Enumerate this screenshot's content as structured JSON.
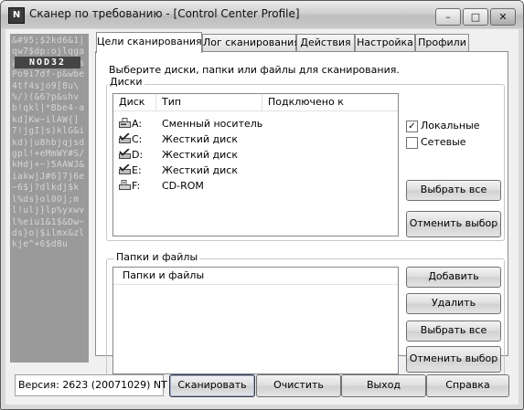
{
  "window": {
    "title": "Сканер по требованию - [Control Center Profile]",
    "minimize": "–",
    "maximize": "□",
    "close": "✕"
  },
  "banner": {
    "logo": "NOD32",
    "chars": "&#95;$2kd6&1|qw7$dp:ojlqgaa6beidewj\\38sPo9i7df-p&wbe4tf4sjo9[8u\\%/)(&6?p&shvb!qkl|*Bbe4-akd]Kw~ilAW{]7!jgI]s)klG&ikd)|u8hbjqjsdgpl!+eMmWY#S/kHdj+~)5AAWJ&iakwjJ#6]7j6e~6$j?dlkdj$kl%ds}ol0Oj;ml!ulj}lp%yxwvl%eiu1&1$&Dw~ds}o|$ilmx&zlkje^+6$d8u"
  },
  "tabs": [
    {
      "label": "Цели сканирования",
      "active": true
    },
    {
      "label": "Лог сканирования",
      "active": false
    },
    {
      "label": "Действия",
      "active": false
    },
    {
      "label": "Настройка",
      "active": false
    },
    {
      "label": "Профили",
      "active": false
    }
  ],
  "targets": {
    "instruction": "Выберите диски, папки или файлы для сканирования.",
    "disks_group_label": "Диски",
    "disk_columns": [
      "Диск",
      "Тип",
      "Подключено к"
    ],
    "disks": [
      {
        "icon": "removable-drive-icon",
        "letter": "A:",
        "type": "Сменный носитель",
        "checked": false
      },
      {
        "icon": "hard-drive-icon",
        "letter": "C:",
        "type": "Жесткий диск",
        "checked": true
      },
      {
        "icon": "hard-drive-icon",
        "letter": "D:",
        "type": "Жесткий диск",
        "checked": true
      },
      {
        "icon": "hard-drive-icon",
        "letter": "E:",
        "type": "Жесткий диск",
        "checked": true
      },
      {
        "icon": "cdrom-drive-icon",
        "letter": "F:",
        "type": "CD-ROM",
        "checked": false
      }
    ],
    "local_checkbox": {
      "label": "Локальные",
      "checked": true
    },
    "network_checkbox": {
      "label": "Сетевые",
      "checked": false
    },
    "select_all_disks": "Выбрать все",
    "deselect_disks": "Отменить выбор",
    "folders_group_label": "Папки и файлы",
    "folders_column": "Папки и файлы",
    "folders": [],
    "add_button": "Добавить",
    "remove_button": "Удалить",
    "select_all_folders": "Выбрать все",
    "deselect_folders": "Отменить выбор"
  },
  "footer": {
    "version": "Версия: 2623 (20071029) NT",
    "scan_button": "Сканировать",
    "clear_button": "Очистить",
    "exit_button": "Выход",
    "help_button": "Справка"
  }
}
